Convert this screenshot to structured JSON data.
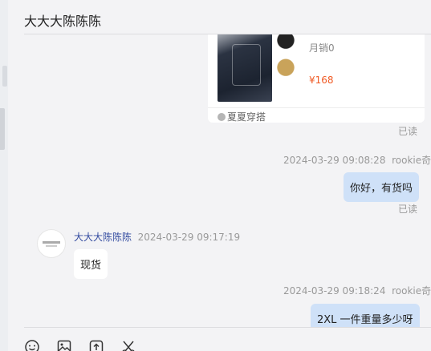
{
  "header": {
    "title": "大大大陈陈陈"
  },
  "product_card": {
    "sales": "月销0",
    "price": "¥168",
    "shop_name": "夏夏穿搭"
  },
  "messages": [
    {
      "status": "已读"
    },
    {
      "timestamp": "2024-03-29 09:08:28",
      "sender": "rookie奇",
      "text": "你好，有货吗",
      "status": "已读"
    },
    {
      "sender": "大大大陈陈陈",
      "timestamp": "2024-03-29 09:17:19",
      "text": "现货"
    },
    {
      "timestamp": "2024-03-29 09:18:24",
      "sender": "rookie奇",
      "text": "2XL 一件重量多少呀"
    }
  ],
  "toolbar": {
    "icons": [
      "emoji-icon",
      "image-icon",
      "upload-icon",
      "scissors-icon"
    ]
  },
  "colors": {
    "own_bubble": "#cfe1f8",
    "price": "#f05a24",
    "sender_name": "#334ba0"
  }
}
